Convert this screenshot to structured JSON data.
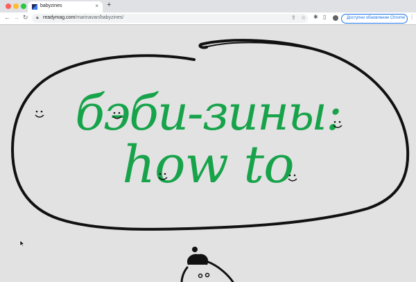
{
  "browser": {
    "tab_title": "babyzines",
    "tab_close": "×",
    "new_tab": "+",
    "url_host": "readymag.com",
    "url_path": "/marinavan/babyzines/",
    "update_button": "Доступно обновление Chrome"
  },
  "page": {
    "title_line1": "бэби-зины:",
    "title_line2": "how to",
    "title_color": "#17a34a",
    "background": "#e2e2e2"
  },
  "icons": {
    "back": "arrow-left",
    "forward": "arrow-right",
    "reload": "reload",
    "lock": "lock",
    "share": "share",
    "bookmark": "star",
    "extensions": "puzzle",
    "side_panel": "side-panel",
    "profile": "person",
    "menu": "more-vertical"
  }
}
